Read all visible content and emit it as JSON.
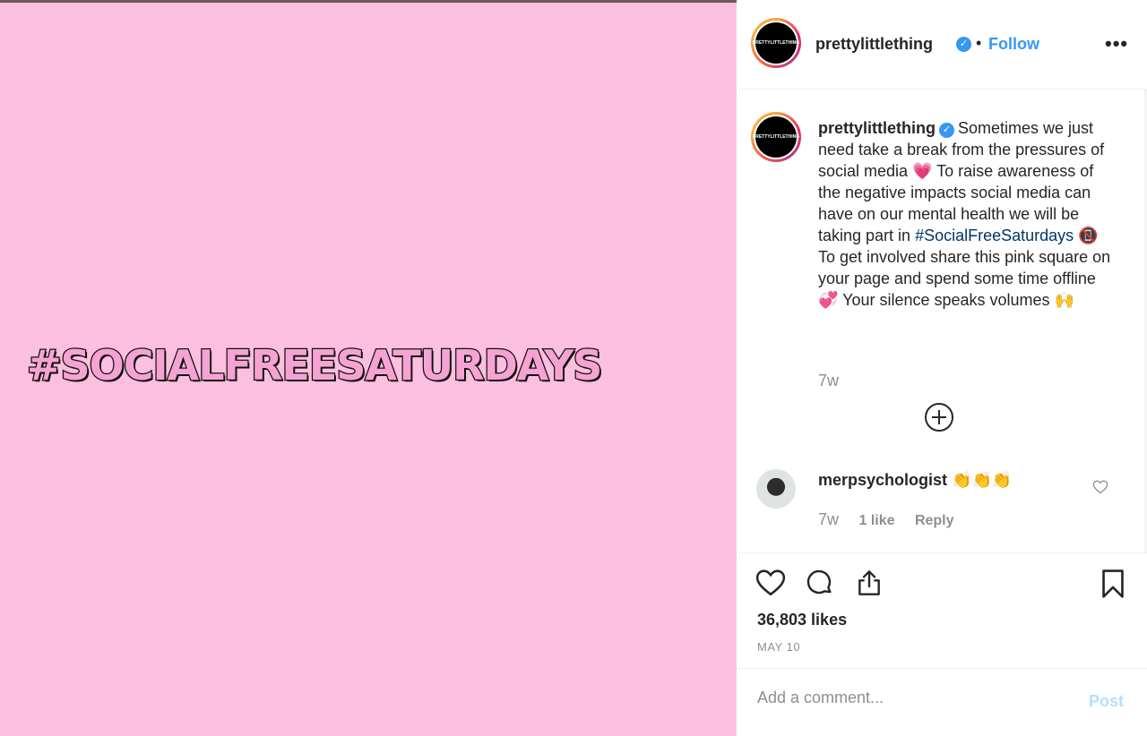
{
  "post_image": {
    "headline": "#SOCIALFREESATURDAYS",
    "background": "#fdbfdf"
  },
  "header": {
    "avatar_text": "PRETTYLITTLETHING",
    "username": "prettylittlething",
    "separator": "•",
    "follow_label": "Follow",
    "more_label": "•••"
  },
  "caption": {
    "username": "prettylittlething",
    "text_part1": "Sometimes we just need take a break from the pressures of social media 💗  To raise awareness of the negative impacts social media can have on our mental health we will be taking part in ",
    "hashtag": "#SocialFreeSaturdays",
    "text_part2": " 📵  To get involved share this pink square on your page and spend some time offline 💞 Your silence speaks volumes 🙌",
    "time": "7w"
  },
  "comment": {
    "username": "merpsychologist",
    "text": "👏👏👏",
    "time": "7w",
    "likes": "1 like",
    "reply_label": "Reply"
  },
  "actions": {
    "likes": "36,803 likes",
    "date": "MAY 10"
  },
  "add_comment": {
    "placeholder": "Add a comment...",
    "post_label": "Post"
  },
  "colors": {
    "accent": "#3897f0",
    "hashtag": "#003569",
    "muted": "#8e8e8e"
  }
}
